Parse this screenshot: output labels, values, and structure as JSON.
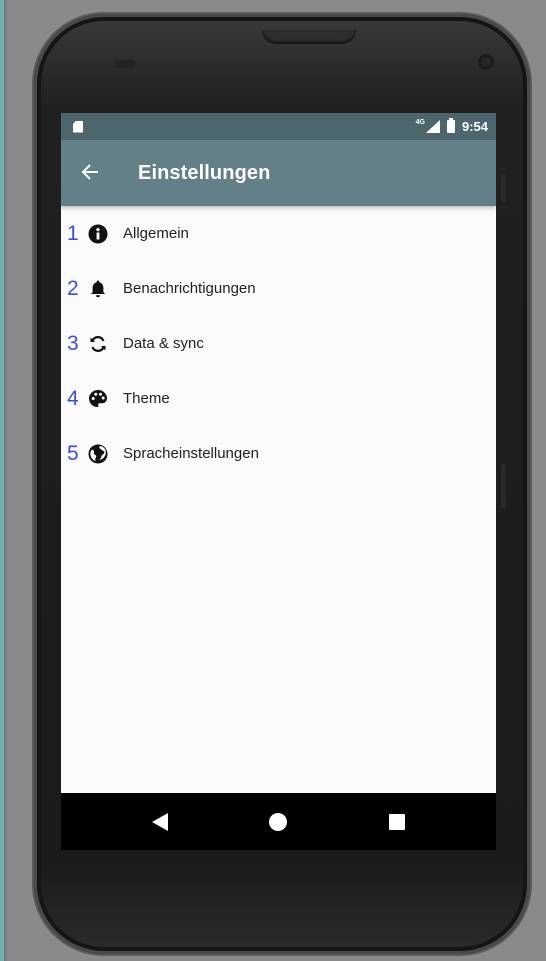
{
  "status_bar": {
    "network": "4G",
    "time": "9:54"
  },
  "app_bar": {
    "back_icon": "arrow-left-icon",
    "title": "Einstellungen",
    "color": "#637f88"
  },
  "settings": {
    "items": [
      {
        "number": "1",
        "icon": "info-icon",
        "label": "Allgemein"
      },
      {
        "number": "2",
        "icon": "bell-icon",
        "label": "Benachrichtigungen"
      },
      {
        "number": "3",
        "icon": "sync-icon",
        "label": "Data & sync"
      },
      {
        "number": "4",
        "icon": "palette-icon",
        "label": "Theme"
      },
      {
        "number": "5",
        "icon": "globe-icon",
        "label": "Spracheinstellungen"
      }
    ]
  },
  "nav_bar": {
    "back": "nav-back-icon",
    "home": "nav-home-icon",
    "recents": "nav-recents-icon"
  }
}
